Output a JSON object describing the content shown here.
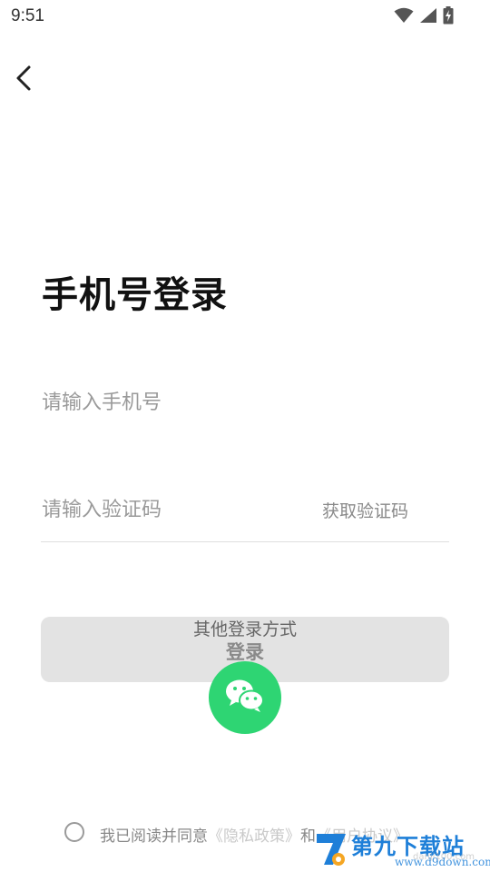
{
  "status_bar": {
    "time": "9:51"
  },
  "page": {
    "title": "手机号登录"
  },
  "form": {
    "phone_placeholder": "请输入手机号",
    "code_placeholder": "请输入验证码",
    "get_code_label": "获取验证码",
    "login_label": "登录"
  },
  "other_login": {
    "label": "其他登录方式"
  },
  "agreement": {
    "prefix": "我已阅读并同意",
    "privacy_link": "《隐私政策》",
    "conjunction": "和",
    "terms_link": "《用户协议》"
  },
  "watermark": {
    "name": "第九下载站",
    "url": "www.d9down.com",
    "url_secondary": "danji100.com"
  },
  "colors": {
    "wechat_green": "#2ed573",
    "login_button_bg": "#e3e3e3",
    "watermark_blue": "#1e7fd8"
  },
  "icons": [
    "wifi-icon",
    "signal-icon",
    "battery-icon",
    "back-arrow-icon",
    "wechat-icon"
  ]
}
